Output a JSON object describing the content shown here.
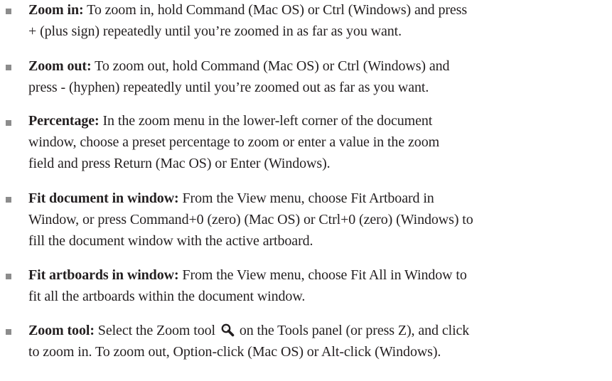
{
  "items": [
    {
      "term": "Zoom in:",
      "lines": [
        "To zoom in, hold Command (Mac OS) or Ctrl (Windows) and press",
        "+ (plus sign) repeatedly until you’re zoomed in as far as you want."
      ]
    },
    {
      "term": "Zoom out:",
      "lines": [
        "To zoom out, hold Command (Mac OS) or Ctrl (Windows) and",
        "press - (hyphen) repeatedly until you’re zoomed out as far as you want."
      ]
    },
    {
      "term": "Percentage:",
      "lines": [
        "In the zoom menu in the lower-left corner of the document",
        "window, choose a preset percentage to zoom or enter a value in the zoom",
        "field and press Return (Mac OS) or Enter (Windows)."
      ]
    },
    {
      "term": "Fit document in window:",
      "lines": [
        "From the View menu, choose Fit Artboard in",
        "Window, or press Command+0 (zero) (Mac OS) or Ctrl+0 (zero) (Windows) to",
        "fill the document window with the active artboard."
      ]
    },
    {
      "term": "Fit artboards in window:",
      "lines": [
        "From the View menu, choose Fit All in Window to",
        "fit all the artboards within the document window."
      ]
    },
    {
      "term": "Zoom tool:",
      "line1_before_icon": "Select the Zoom tool",
      "icon": "zoom-tool-icon",
      "line1_after_icon": "on the Tools panel (or press Z), and click",
      "line2": "to zoom in. To zoom out, Option-click (Mac OS) or Alt-click (Windows)."
    }
  ],
  "colors": {
    "text": "#231f20",
    "bullet": "#8c8c8c"
  }
}
